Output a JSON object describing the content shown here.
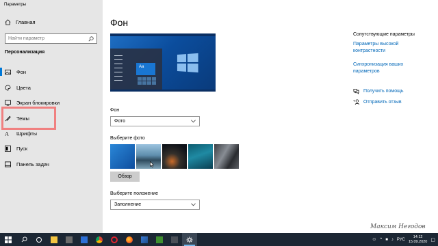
{
  "window": {
    "title": "Параметры"
  },
  "sidebar": {
    "home_label": "Главная",
    "search_placeholder": "Найти параметр",
    "section_title": "Персонализация",
    "items": [
      {
        "label": "Фон",
        "icon": "picture-icon",
        "selected": true
      },
      {
        "label": "Цвета",
        "icon": "palette-icon"
      },
      {
        "label": "Экран блокировки",
        "icon": "lock-screen-icon"
      },
      {
        "label": "Темы",
        "icon": "brush-icon",
        "highlighted": true
      },
      {
        "label": "Шрифты",
        "icon": "font-icon"
      },
      {
        "label": "Пуск",
        "icon": "start-icon"
      },
      {
        "label": "Панель задач",
        "icon": "taskbar-icon"
      }
    ]
  },
  "main": {
    "title": "Фон",
    "preview_tile_text": "Aa",
    "background_label": "Фон",
    "background_value": "Фото",
    "choose_photo_label": "Выберите фото",
    "browse_label": "Обзор",
    "position_label": "Выберите положение",
    "position_value": "Заполнение"
  },
  "related": {
    "title": "Сопутствующие параметры",
    "link1": "Параметры высокой контрастности",
    "link2": "Синхронизация ваших параметров",
    "help": "Получить помощь",
    "feedback": "Отправить отзыв"
  },
  "taskbar": {
    "language": "РУС",
    "time": "14:12",
    "date": "15.09.2020"
  },
  "watermark": "Максим Негодов",
  "colors": {
    "accent": "#0078d7",
    "link": "#0067b8",
    "highlight": "#f08080",
    "taskbar": "#1c2734"
  }
}
